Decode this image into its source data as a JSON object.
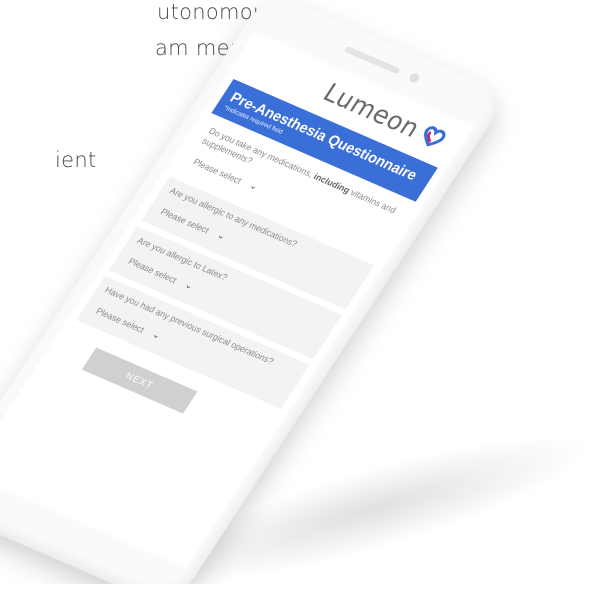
{
  "background_text": [
    "utonomously",
    "am members",
    "ient"
  ],
  "app": {
    "logo_text": "Lumeon",
    "brand_color": "#3a6fd8"
  },
  "form": {
    "title": "Pre-Anesthesia Questionnaire",
    "subtitle": "*Indicates required field",
    "questions": [
      {
        "text_main": "Do you take any medications, ",
        "text_bold": "including",
        "text_rest": " vitamins and supplements?",
        "select": "Please select"
      },
      {
        "text": "Are you allergic to any medications?",
        "select": "Please select"
      },
      {
        "text": "Are you allergic to Latex?",
        "select": "Please select"
      },
      {
        "text": "Have you had any previous surgical operations?",
        "select": "Please select"
      }
    ],
    "next_label": "NEXT"
  }
}
